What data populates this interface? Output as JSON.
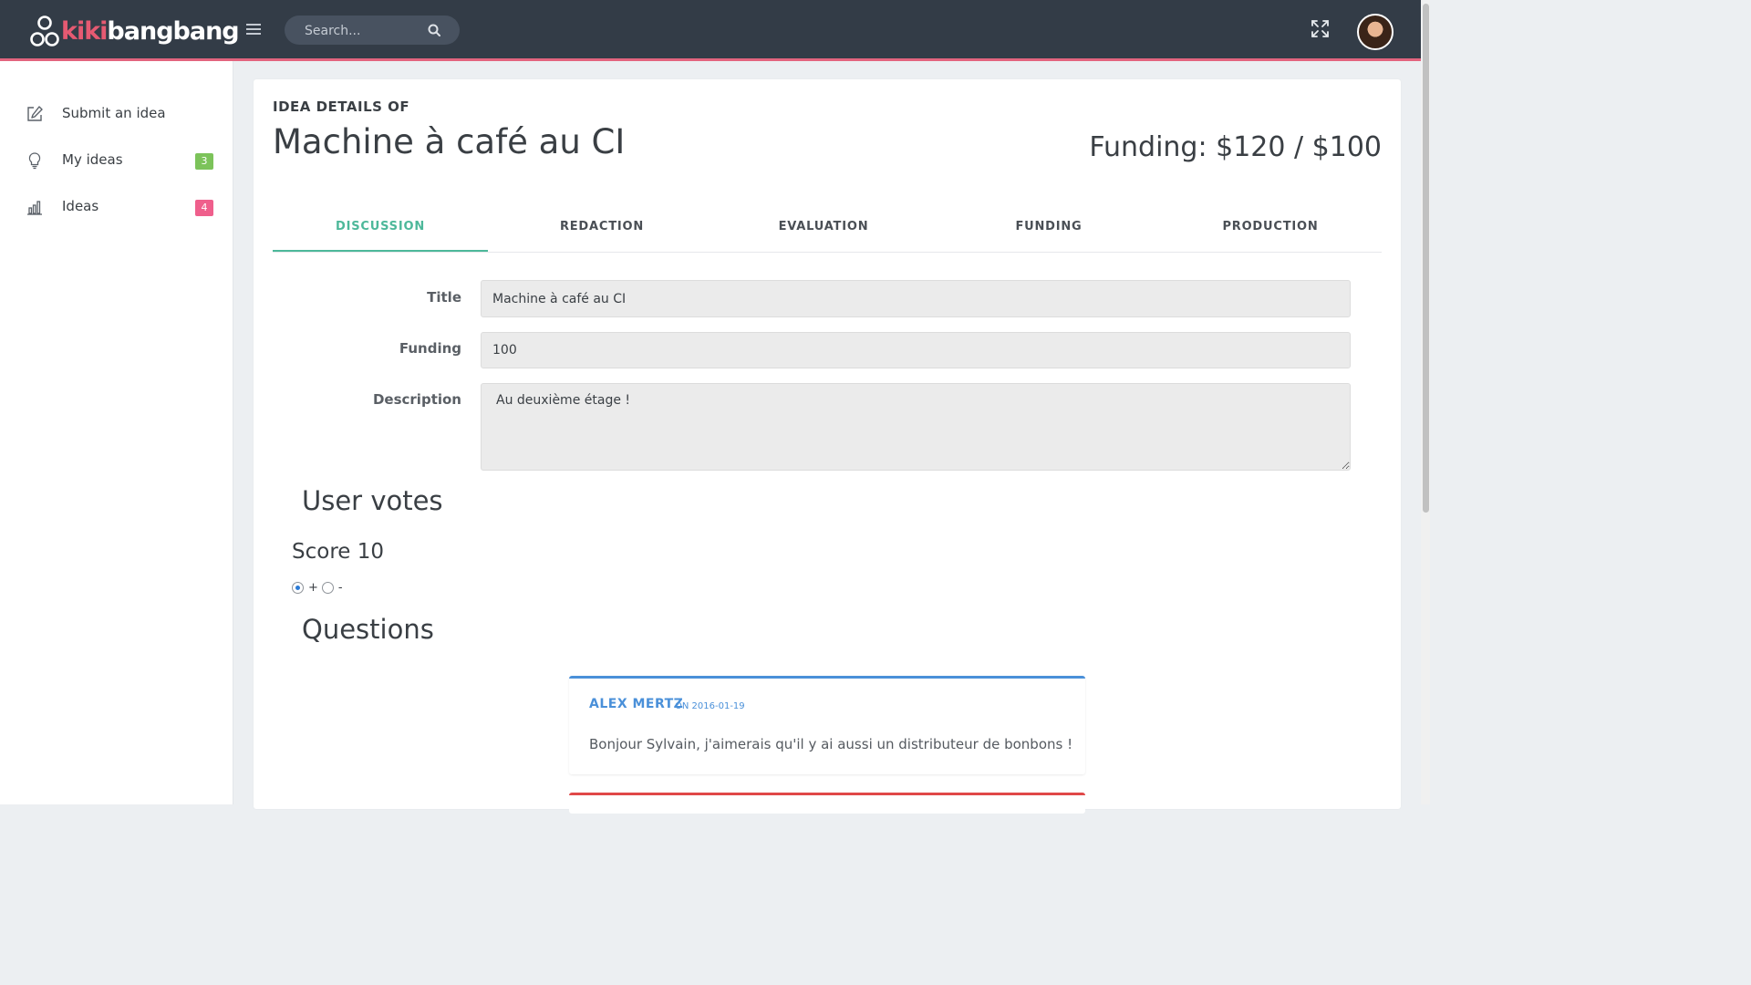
{
  "brand": {
    "name_part1": "kiki",
    "name_part2": "bangbang"
  },
  "search": {
    "placeholder": "Search..."
  },
  "sidebar": {
    "items": [
      {
        "label": "Submit an idea",
        "icon": "edit-icon"
      },
      {
        "label": "My ideas",
        "icon": "lightbulb-icon",
        "badge": "3",
        "badge_color": "#7cc35a"
      },
      {
        "label": "Ideas",
        "icon": "bar-chart-icon",
        "badge": "4",
        "badge_color": "#ef5f8c"
      }
    ]
  },
  "header": {
    "eyebrow": "IDEA DETAILS OF",
    "title": "Machine à café au CI",
    "funding_summary": "Funding: $120 / $100"
  },
  "tabs": [
    {
      "label": "DISCUSSION",
      "active": true
    },
    {
      "label": "REDACTION"
    },
    {
      "label": "EVALUATION"
    },
    {
      "label": "FUNDING"
    },
    {
      "label": "PRODUCTION"
    }
  ],
  "form": {
    "title_label": "Title",
    "title_value": "Machine à café au CI",
    "funding_label": "Funding",
    "funding_value": "100",
    "description_label": "Description",
    "description_value": "Au deuxième étage !"
  },
  "votes": {
    "heading": "User votes",
    "score_label": "Score 10",
    "plus_label": "+",
    "minus_label": "-",
    "selected": "+"
  },
  "questions": {
    "heading": "Questions",
    "items": [
      {
        "author": "ALEX MERTZ",
        "date": "ON 2016-01-19",
        "body": "Bonjour Sylvain, j'aimerais qu'il y ai aussi un distributeur de bonbons !",
        "accent": "#4a90d9"
      }
    ],
    "next_item_accent": "#e04848"
  },
  "colors": {
    "topbar": "#333c47",
    "brand_pink": "#e65a72",
    "tab_active": "#4db89a"
  }
}
